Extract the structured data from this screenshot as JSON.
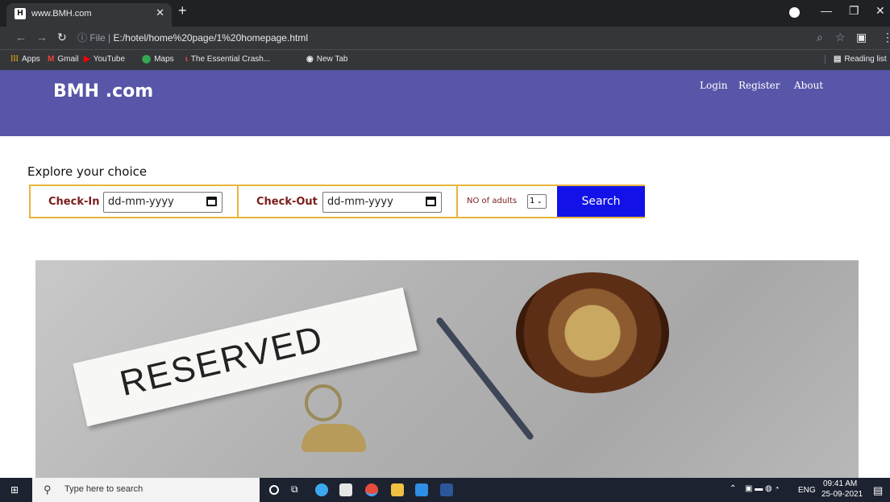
{
  "browser": {
    "tab_title": "www.BMH.com",
    "tab_favicon": "H",
    "url_prefix": "File",
    "url": "E:/hotel/home%20page/1%20homepage.html",
    "bookmarks": [
      "Apps",
      "Gmail",
      "YouTube",
      "Maps",
      "The Essential Crash...",
      "New Tab"
    ],
    "reading_list": "Reading list"
  },
  "site": {
    "logo": "BMH .com",
    "nav": [
      "Login",
      "Register",
      "About"
    ],
    "header_color": "#5856a8"
  },
  "booking": {
    "heading": "Explore your choice",
    "checkin_label": "Check-In",
    "checkout_label": "Check-Out",
    "date_placeholder": "dd-mm-yyyy",
    "adults_label": "NO of adults",
    "adults_value": "1",
    "search_label": "Search"
  },
  "hero": {
    "sign_text": "RESERVED"
  },
  "taskbar": {
    "search_placeholder": "Type here to search",
    "lang": "ENG",
    "time": "09:41 AM",
    "date": "25-09-2021"
  }
}
